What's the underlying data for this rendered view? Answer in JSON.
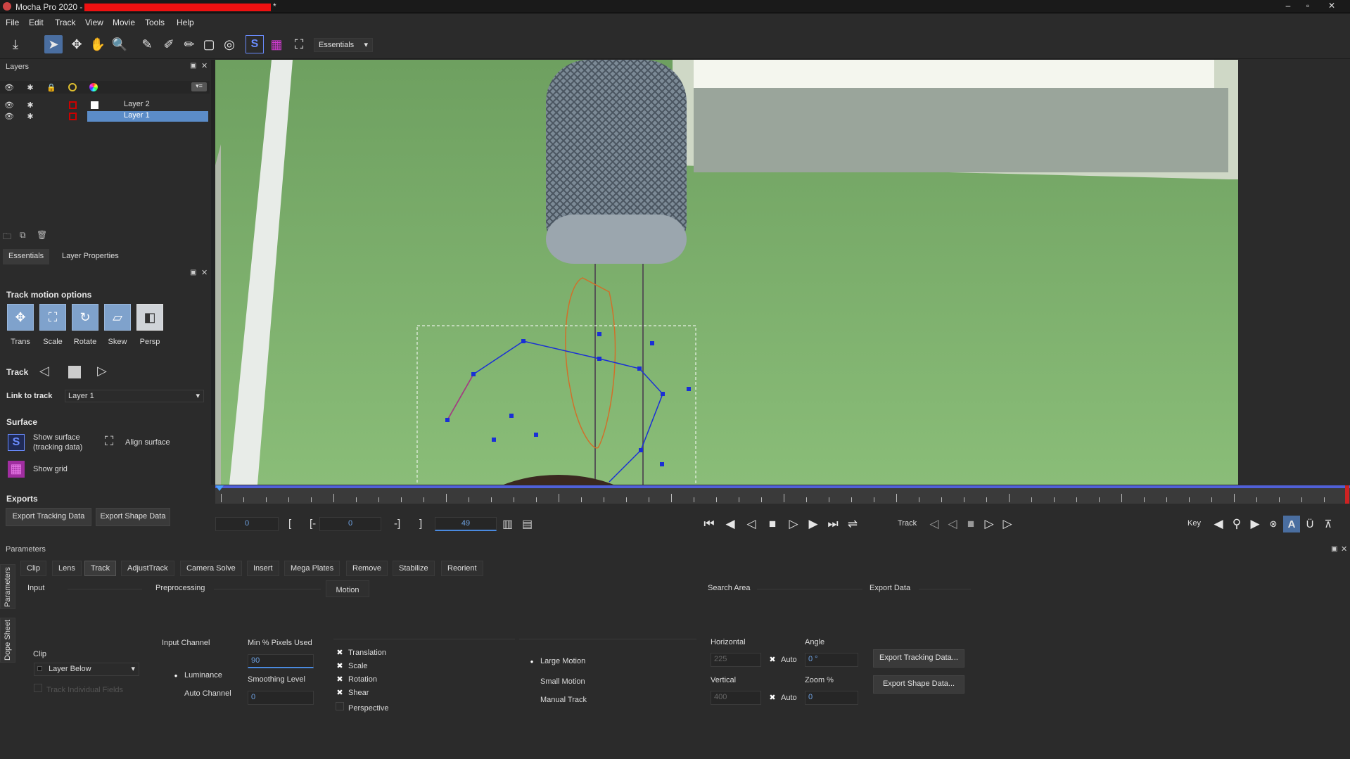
{
  "titlebar": {
    "title": "Mocha Pro 2020 -",
    "modified_mark": "*",
    "controls": [
      "–",
      "▫",
      "✕"
    ]
  },
  "menu": [
    "File",
    "Edit",
    "Track",
    "View",
    "Movie",
    "Tools",
    "Help"
  ],
  "toolbar": {
    "workspace": "Essentials"
  },
  "layers": {
    "title": "Layers",
    "rows": [
      {
        "name": "Layer 2",
        "selected": false
      },
      {
        "name": "Layer 1",
        "selected": true
      }
    ]
  },
  "props": {
    "tabs": [
      "Essentials",
      "Layer Properties"
    ],
    "track_motion_title": "Track motion options",
    "motion_buttons": [
      "Trans",
      "Scale",
      "Rotate",
      "Skew",
      "Persp"
    ],
    "track_label": "Track",
    "link_label": "Link to track",
    "link_value": "Layer 1",
    "surface_title": "Surface",
    "show_surface": "Show surface\n(tracking data)",
    "align_surface": "Align surface",
    "show_grid": "Show grid",
    "exports_title": "Exports",
    "export_tracking": "Export Tracking Data",
    "export_shape": "Export Shape Data"
  },
  "transport": {
    "in_frame": "0",
    "current": "0",
    "out_frame": "49",
    "bracket_open": "[",
    "bracket_in": "[-",
    "bracket_out": "-]",
    "bracket_close": "]",
    "track_label": "Track",
    "key_label": "Key"
  },
  "params": {
    "title": "Parameters",
    "tabs": [
      "Clip",
      "Lens",
      "Track",
      "AdjustTrack",
      "Camera Solve",
      "Insert",
      "Mega Plates",
      "Remove",
      "Stabilize",
      "Reorient"
    ],
    "selected_tab": "Track",
    "side_tabs": [
      "Parameters",
      "Dope Sheet"
    ],
    "input": {
      "title": "Input",
      "clip_label": "Clip",
      "clip_value": "Layer Below",
      "track_individual": "Track Individual Fields"
    },
    "preprocessing": {
      "title": "Preprocessing",
      "input_channel": "Input Channel",
      "luminance": "Luminance",
      "auto_channel": "Auto Channel",
      "min_pixels_label": "Min % Pixels Used",
      "min_pixels_value": "90",
      "smoothing_label": "Smoothing Level",
      "smoothing_value": "0"
    },
    "motion": {
      "title": "Motion",
      "checks": [
        {
          "label": "Translation",
          "checked": true
        },
        {
          "label": "Scale",
          "checked": true
        },
        {
          "label": "Rotation",
          "checked": true
        },
        {
          "label": "Shear",
          "checked": true
        },
        {
          "label": "Perspective",
          "checked": false
        }
      ],
      "radios": [
        {
          "label": "Large Motion",
          "selected": true
        },
        {
          "label": "Small Motion",
          "selected": false
        },
        {
          "label": "Manual Track",
          "selected": false
        }
      ]
    },
    "search": {
      "title": "Search Area",
      "horizontal": "Horizontal",
      "horizontal_value": "225",
      "vertical": "Vertical",
      "vertical_value": "400",
      "auto": "Auto",
      "angle": "Angle",
      "angle_value": "0 °",
      "zoom": "Zoom %",
      "zoom_value": "0"
    },
    "export": {
      "title": "Export Data",
      "tracking": "Export Tracking Data...",
      "shape": "Export Shape Data..."
    }
  },
  "colors": {
    "accent": "#5b8cc8",
    "redaction": "#e11111",
    "green_screen": "#6a9b5c",
    "spline_blue": "#1a2fd6",
    "spline_orange": "#d0702a"
  }
}
